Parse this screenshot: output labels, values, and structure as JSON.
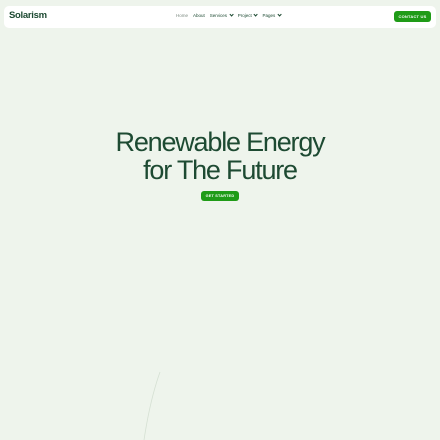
{
  "header": {
    "logo": "Solarism",
    "nav": [
      {
        "label": "Home",
        "dropdown": false,
        "active": true
      },
      {
        "label": "About",
        "dropdown": false,
        "active": false
      },
      {
        "label": "Services",
        "dropdown": true,
        "active": false
      },
      {
        "label": "Project",
        "dropdown": true,
        "active": false
      },
      {
        "label": "Pages",
        "dropdown": true,
        "active": false
      }
    ],
    "contact_label": "CONTACT US"
  },
  "hero": {
    "title_line1": "Renewable Energy",
    "title_line2": "for The Future",
    "cta_label": "GET STARTED"
  },
  "colors": {
    "background": "#eef4ec",
    "brand_dark": "#1d4a32",
    "accent_green": "#1f9b17"
  }
}
